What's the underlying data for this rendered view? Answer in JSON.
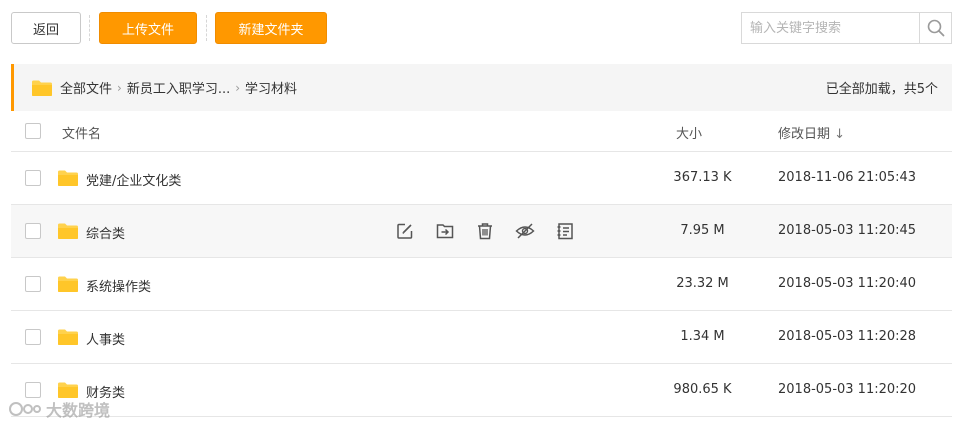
{
  "toolbar": {
    "back_label": "返回",
    "upload_label": "上传文件",
    "newfolder_label": "新建文件夹"
  },
  "search": {
    "placeholder": "输入关键字搜索",
    "icon": "search-icon"
  },
  "breadcrumb": {
    "items": [
      "全部文件",
      "新员工入职学习...",
      "学习材料"
    ],
    "status": "已全部加载，共5个"
  },
  "table": {
    "columns": {
      "name": "文件名",
      "size": "大小",
      "date": "修改日期"
    },
    "sort_indicator": "↓",
    "rows": [
      {
        "name": "党建/企业文化类",
        "size": "367.13 K",
        "date": "2018-11-06 21:05:43"
      },
      {
        "name": "综合类",
        "size": "7.95 M",
        "date": "2018-05-03 11:20:45"
      },
      {
        "name": "系统操作类",
        "size": "23.32 M",
        "date": "2018-05-03 11:20:40"
      },
      {
        "name": "人事类",
        "size": "1.34 M",
        "date": "2018-05-03 11:20:28"
      },
      {
        "name": "财务类",
        "size": "980.65 K",
        "date": "2018-05-03 11:20:20"
      }
    ],
    "hover_actions": [
      "edit-icon",
      "move-icon",
      "delete-icon",
      "hide-icon",
      "details-icon"
    ]
  },
  "watermark": {
    "text": "大数跨境"
  },
  "colors": {
    "accent": "#ff9800",
    "folder": "#ffd24d"
  }
}
